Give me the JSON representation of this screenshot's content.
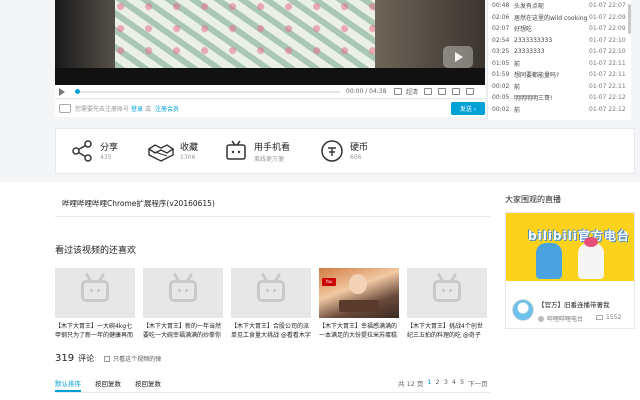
{
  "player": {
    "time_display": "00:00 / 04:38",
    "ctrl_quality": "超清",
    "ctrl_loop": "弹幕",
    "danmaku_notice_prefix": "您需要先去注册账号",
    "login_label": "登录",
    "or_label": "或",
    "register_label": "注册会员",
    "send_label": "发送 ›"
  },
  "danmaku_list": [
    {
      "time": "00:48",
      "content": "头发有点呢",
      "date": "01-07 22:07"
    },
    {
      "time": "02:06",
      "content": "居然在这里的wild cooking",
      "date": "01-07 22:09"
    },
    {
      "time": "02:07",
      "content": "好想吃",
      "date": "01-07 22:09"
    },
    {
      "time": "02:54",
      "content": "2333333333",
      "date": "01-07 22:10"
    },
    {
      "time": "03:25",
      "content": "23333333",
      "date": "01-07 22:10"
    },
    {
      "time": "01:05",
      "content": "前",
      "date": "01-07 22:11"
    },
    {
      "time": "01:59",
      "content": "想同要都能量吗?",
      "date": "01-07 22:11"
    },
    {
      "time": "00:02",
      "content": "前",
      "date": "01-07 22:11"
    },
    {
      "time": "00:05",
      "content": "明明明明三哥!",
      "date": "01-07 22:12"
    },
    {
      "time": "00:02",
      "content": "前",
      "date": "01-07 22:12"
    }
  ],
  "actions": {
    "share": {
      "label": "分享",
      "count": "435"
    },
    "favorite": {
      "label": "收藏",
      "count": "1306"
    },
    "mobile": {
      "label": "用手机看",
      "sub": "离线更方便"
    },
    "coin": {
      "label": "硬币",
      "count": "606"
    }
  },
  "description": "哔哩哔哩哔哩Chrome扩展程序(v20160615)",
  "recommend": {
    "title": "看过该视频的还喜欢",
    "items": [
      {
        "text": "【木下大胃王】一大碗4kg七甲钢只为了新一年的健康再而"
      },
      {
        "text": "【木下大胃王】新的一年当然要吃一大碗幸福满满的炒拳你"
      },
      {
        "text": "【木下大胃王】合股公司的派单见工食量大挑战 @看看木字"
      },
      {
        "text": "【木下大胃王】幸福感满满的一本满足的大份提拉米苏蛋糕 @"
      },
      {
        "text": "【木下大胃王】挑战4个创世纪三五拍的料理的吃 @奇子"
      }
    ]
  },
  "comments": {
    "count": "319",
    "label": "评论",
    "checkbox_label": "只看这个视频的弹",
    "tabs": [
      "默认排序",
      "按回复数",
      "按回复数"
    ],
    "pager": {
      "total": "共 12 页",
      "pages": [
        "1",
        "2",
        "3",
        "4",
        "5"
      ],
      "next": "下一页"
    }
  },
  "live": {
    "title": "大家围观的直播",
    "banner_text": "bilibili官方电台",
    "name": "【官方】旧番连播带著我",
    "user": "哔哩哔哩电台",
    "views": "1552"
  },
  "colors": {
    "accent": "#00a1d6",
    "banner": "#fcd21c"
  }
}
